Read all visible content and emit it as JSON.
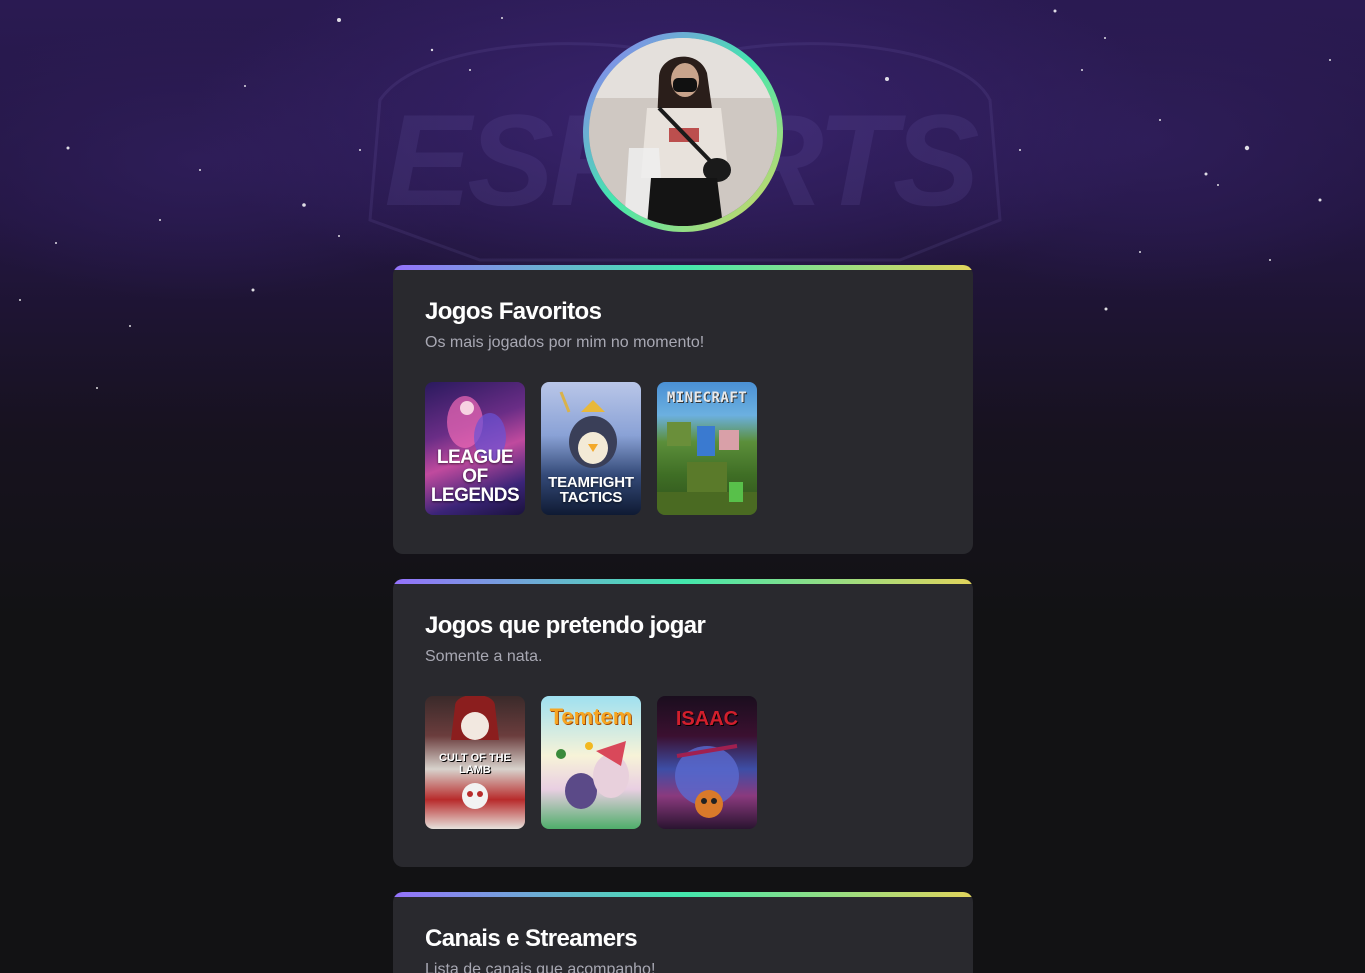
{
  "profile": {
    "avatar_alt": "profile-photo"
  },
  "sections": [
    {
      "title": "Jogos Favoritos",
      "subtitle": "Os mais jogados por mim no momento!",
      "games": [
        {
          "name": "LEAGUE OF LEGENDS",
          "label": "LEAGUE OF LEGENDS"
        },
        {
          "name": "TEAMFIGHT TACTICS",
          "label": "TEAMFIGHT TACTICS"
        },
        {
          "name": "MINECRAFT",
          "label": "MINECRAFT"
        }
      ]
    },
    {
      "title": "Jogos que pretendo jogar",
      "subtitle": "Somente a nata.",
      "games": [
        {
          "name": "CULT OF THE LAMB",
          "label": "CULT OF THE LAMB"
        },
        {
          "name": "Temtem",
          "label": "Temtem"
        },
        {
          "name": "ISAAC",
          "label": "ISAAC"
        }
      ]
    },
    {
      "title": "Canais e Streamers",
      "subtitle": "Lista de canais que acompanho!"
    }
  ],
  "background_text": "ESPORTS",
  "colors": {
    "accent_start": "#9572fc",
    "accent_mid": "#43e7ad",
    "accent_end": "#e2d45c",
    "card_bg": "#29292e",
    "page_bg": "#121214"
  }
}
